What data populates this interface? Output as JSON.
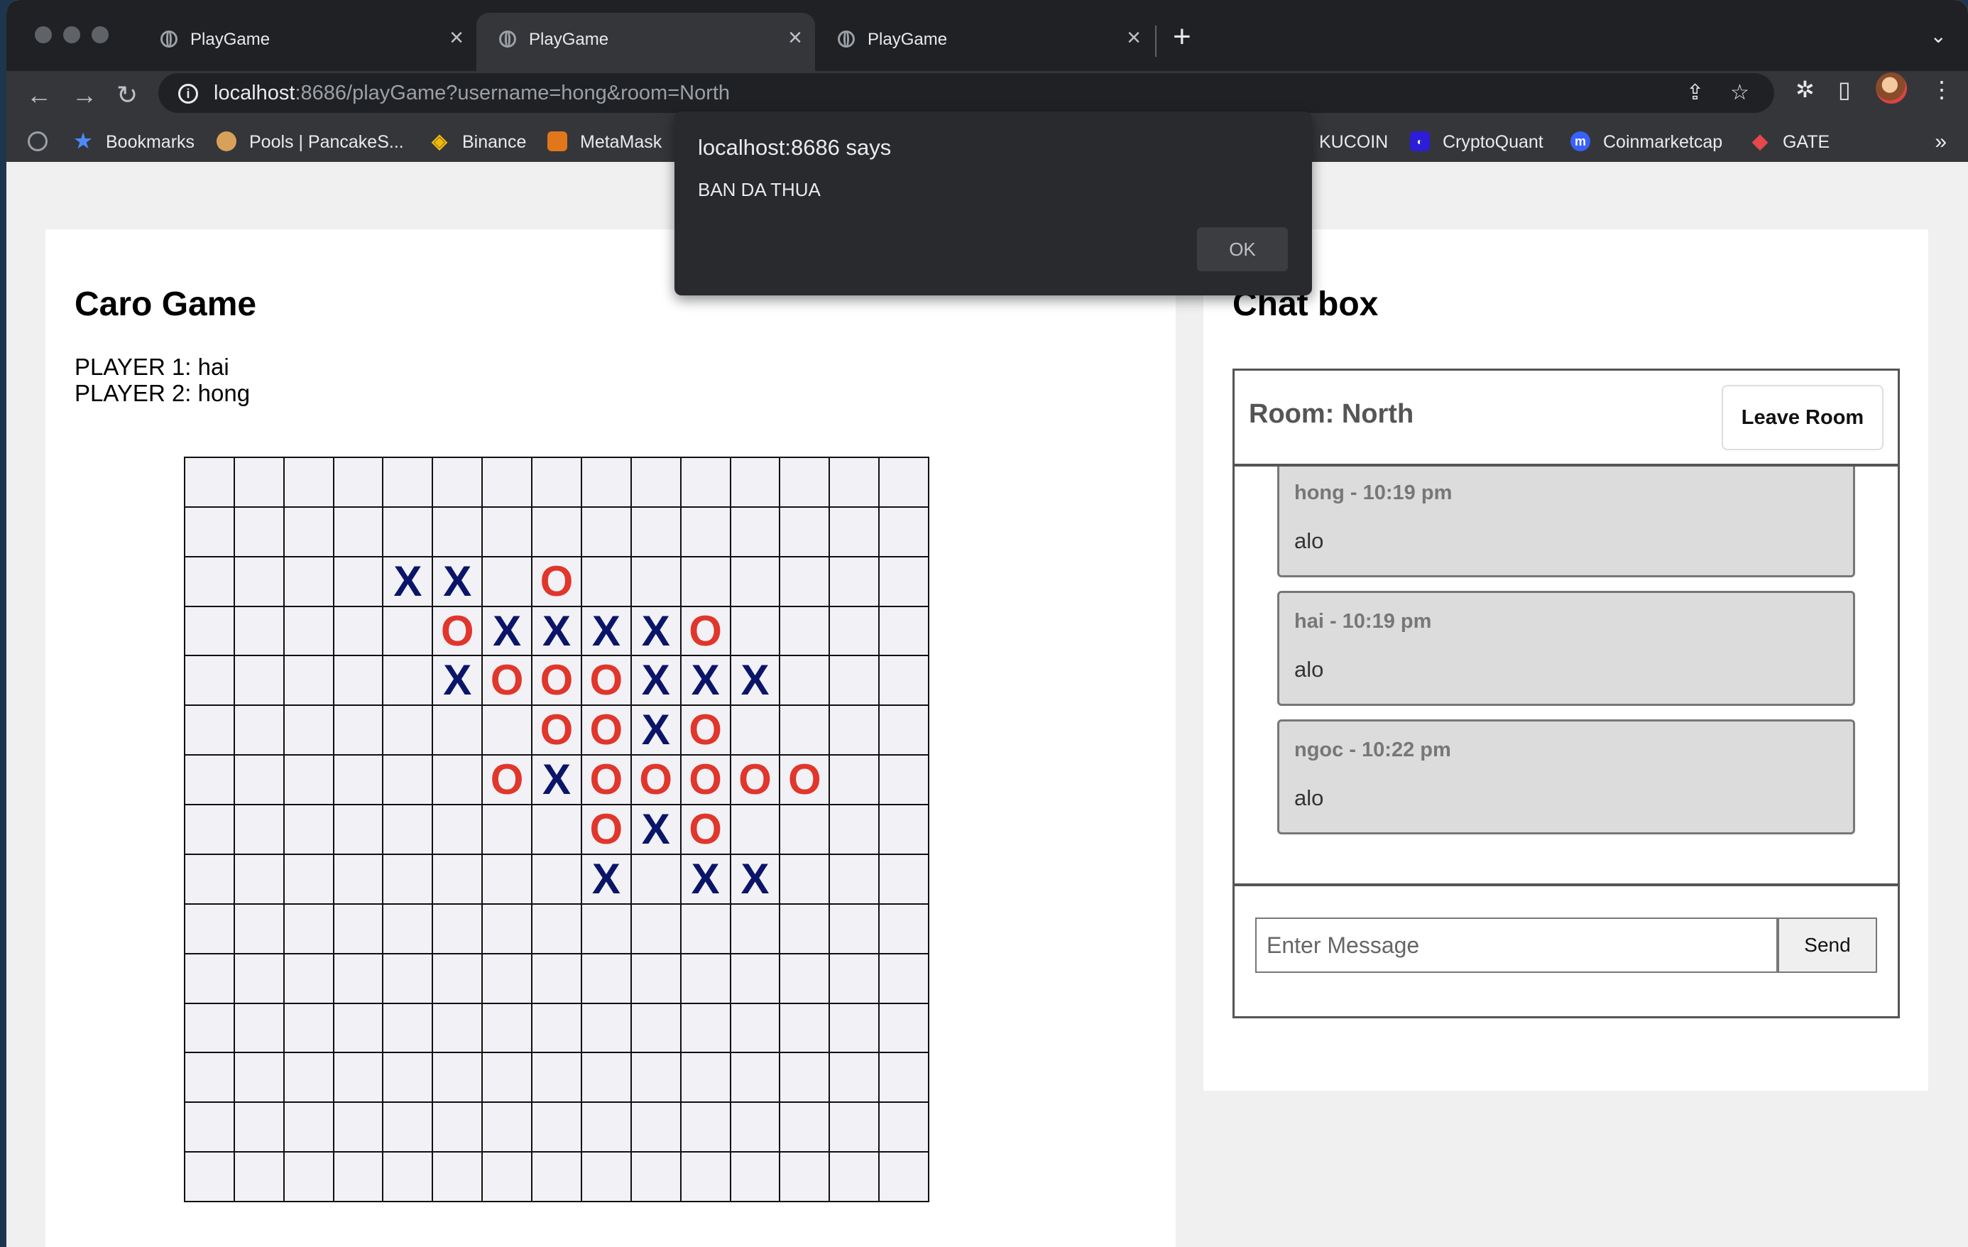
{
  "browser": {
    "tabs": [
      {
        "title": "PlayGame",
        "close": "×"
      },
      {
        "title": "PlayGame",
        "close": "×"
      },
      {
        "title": "PlayGame",
        "close": "×"
      }
    ],
    "new_tab": "+",
    "url_host": "localhost",
    "url_rest": ":8686/playGame?username=hong&room=North",
    "bookmarks": [
      {
        "label": "Bookmarks",
        "icon": "star-icon"
      },
      {
        "label": "Pools | PancakeS...",
        "icon": "pancake-icon"
      },
      {
        "label": "Binance",
        "icon": "binance-icon"
      },
      {
        "label": "MetaMask",
        "icon": "metamask-icon"
      },
      {
        "label": "KUCOIN",
        "icon": ""
      },
      {
        "label": "CryptoQuant",
        "icon": "cryptoquant-icon"
      },
      {
        "label": "Coinmarketcap",
        "icon": "coinmarketcap-icon"
      },
      {
        "label": "GATE",
        "icon": "gate-icon"
      }
    ],
    "bookmarks_overflow": "»"
  },
  "game": {
    "title": "Caro Game",
    "player1": "PLAYER 1: hai",
    "player2": "PLAYER 2: hong",
    "board": [
      "...............",
      "...............",
      "....XX.O.......",
      ".....OXXXXO....",
      ".....XOOOXXX...",
      ".......OOXO....",
      "......OXOOOOO..",
      "........OXO....",
      "........X.XX...",
      "...............",
      "...............",
      "...............",
      "...............",
      "...............",
      "..............."
    ],
    "colors": {
      "x": "#0a1468",
      "o": "#e0362b"
    }
  },
  "chat": {
    "title": "Chat box",
    "room": "Room: North",
    "leave_label": "Leave Room",
    "messages": [
      {
        "meta": "hong - 10:19 pm",
        "text": "alo"
      },
      {
        "meta": "hai - 10:19 pm",
        "text": "alo"
      },
      {
        "meta": "ngoc - 10:22 pm",
        "text": "alo"
      }
    ],
    "input_placeholder": "Enter Message",
    "send_label": "Send"
  },
  "alert": {
    "title": "localhost:8686 says",
    "message": "BAN DA THUA",
    "ok_label": "OK"
  }
}
